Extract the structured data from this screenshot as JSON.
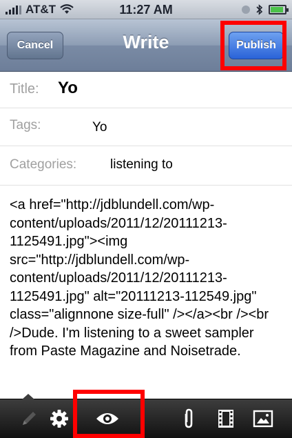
{
  "status_bar": {
    "carrier": "AT&T",
    "time": "11:27 AM",
    "signal_icon": "signal-bars-icon",
    "wifi_icon": "wifi-icon",
    "location_icon": "location-icon",
    "bluetooth_icon": "bluetooth-icon",
    "battery_icon": "battery-icon",
    "battery_level": 0.75
  },
  "nav_bar": {
    "title": "Write",
    "cancel_label": "Cancel",
    "publish_label": "Publish"
  },
  "form": {
    "title_label": "Title:",
    "title_value": "Yo",
    "tags_label": "Tags:",
    "tags_value": "Yo",
    "categories_label": "Categories:",
    "categories_value": "listening to",
    "body": "<a href=\"http://jdblundell.com/wp-content/uploads/2011/12/20111213-1125491.jpg\"><img src=\"http://jdblundell.com/wp-content/uploads/2011/12/20111213-1125491.jpg\" alt=\"20111213-112549.jpg\" class=\"alignnone size-full\" /></a><br /><br />Dude. I'm listening to a sweet sampler from Paste Magazine and Noisetrade."
  },
  "toolbar": {
    "items": [
      "pencil-icon",
      "gear-icon",
      "eye-icon",
      "paperclip-icon",
      "film-icon",
      "image-icon"
    ]
  },
  "colors": {
    "highlight": "#ff0000",
    "publish_button": "#2a63d8",
    "nav_bar": "#8d9db4"
  }
}
